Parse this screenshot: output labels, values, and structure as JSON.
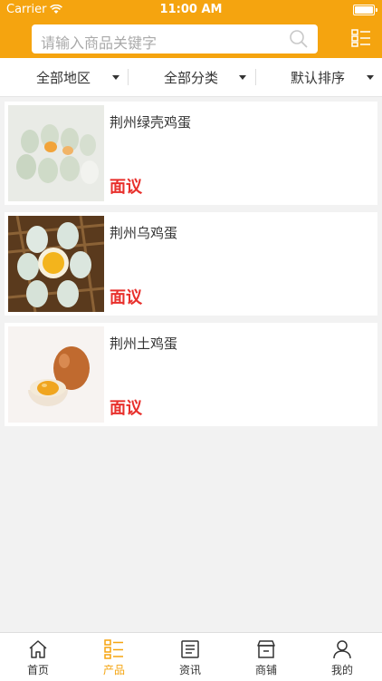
{
  "status_bar": {
    "carrier": "Carrier",
    "time": "11:00 AM"
  },
  "search": {
    "placeholder": "请输入商品关键字"
  },
  "filters": [
    {
      "label": "全部地区"
    },
    {
      "label": "全部分类"
    },
    {
      "label": "默认排序"
    }
  ],
  "products": [
    {
      "title": "荆州绿壳鸡蛋",
      "price": "面议"
    },
    {
      "title": "荆州乌鸡蛋",
      "price": "面议"
    },
    {
      "title": "荆州土鸡蛋",
      "price": "面议"
    }
  ],
  "tabs": [
    {
      "label": "首页",
      "icon": "home-icon"
    },
    {
      "label": "产品",
      "icon": "list-icon"
    },
    {
      "label": "资讯",
      "icon": "news-icon"
    },
    {
      "label": "商铺",
      "icon": "shop-icon"
    },
    {
      "label": "我的",
      "icon": "user-icon"
    }
  ],
  "colors": {
    "accent": "#f5a40f",
    "price": "#e8302c"
  }
}
